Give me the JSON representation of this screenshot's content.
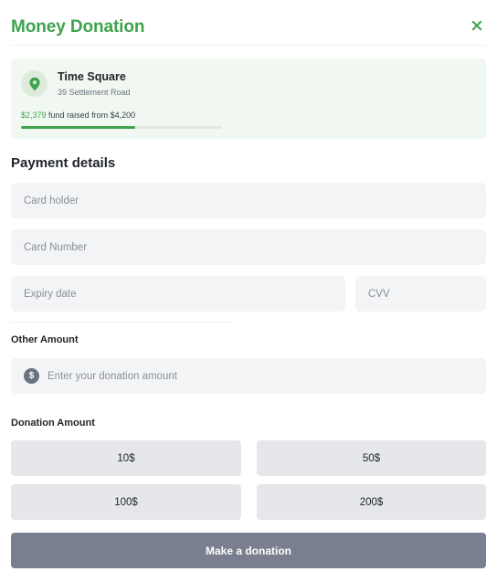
{
  "dialog": {
    "title": "Money Donation",
    "close_icon": "close-icon"
  },
  "campaign": {
    "icon": "location-pin-icon",
    "name": "Time Square",
    "address": "39 Settlement Road",
    "raised": "$2,379",
    "raised_text": "fund raised from $4,200",
    "goal": "$4,200",
    "progress_fraction": 0.566
  },
  "payment": {
    "heading": "Payment details",
    "card_holder_placeholder": "Card holder",
    "card_holder_value": "",
    "card_number_placeholder": "Card Number",
    "card_number_value": "",
    "expiry_placeholder": "Expiry date",
    "expiry_value": "",
    "cvv_placeholder": "CVV",
    "cvv_value": ""
  },
  "other_amount": {
    "label": "Other Amount",
    "icon": "dollar-icon",
    "icon_glyph": "$",
    "placeholder": "Enter your donation amount",
    "value": ""
  },
  "donation_amount": {
    "label": "Donation Amount",
    "options": [
      "10$",
      "50$",
      "100$",
      "200$"
    ]
  },
  "submit_label": "Make a donation",
  "colors": {
    "accent": "#3fa34d",
    "campaign_bg": "#f1f8f1",
    "field_bg": "#f3f4f6",
    "amount_button_bg": "#e5e7eb",
    "submit_bg": "#7a7f8f"
  }
}
